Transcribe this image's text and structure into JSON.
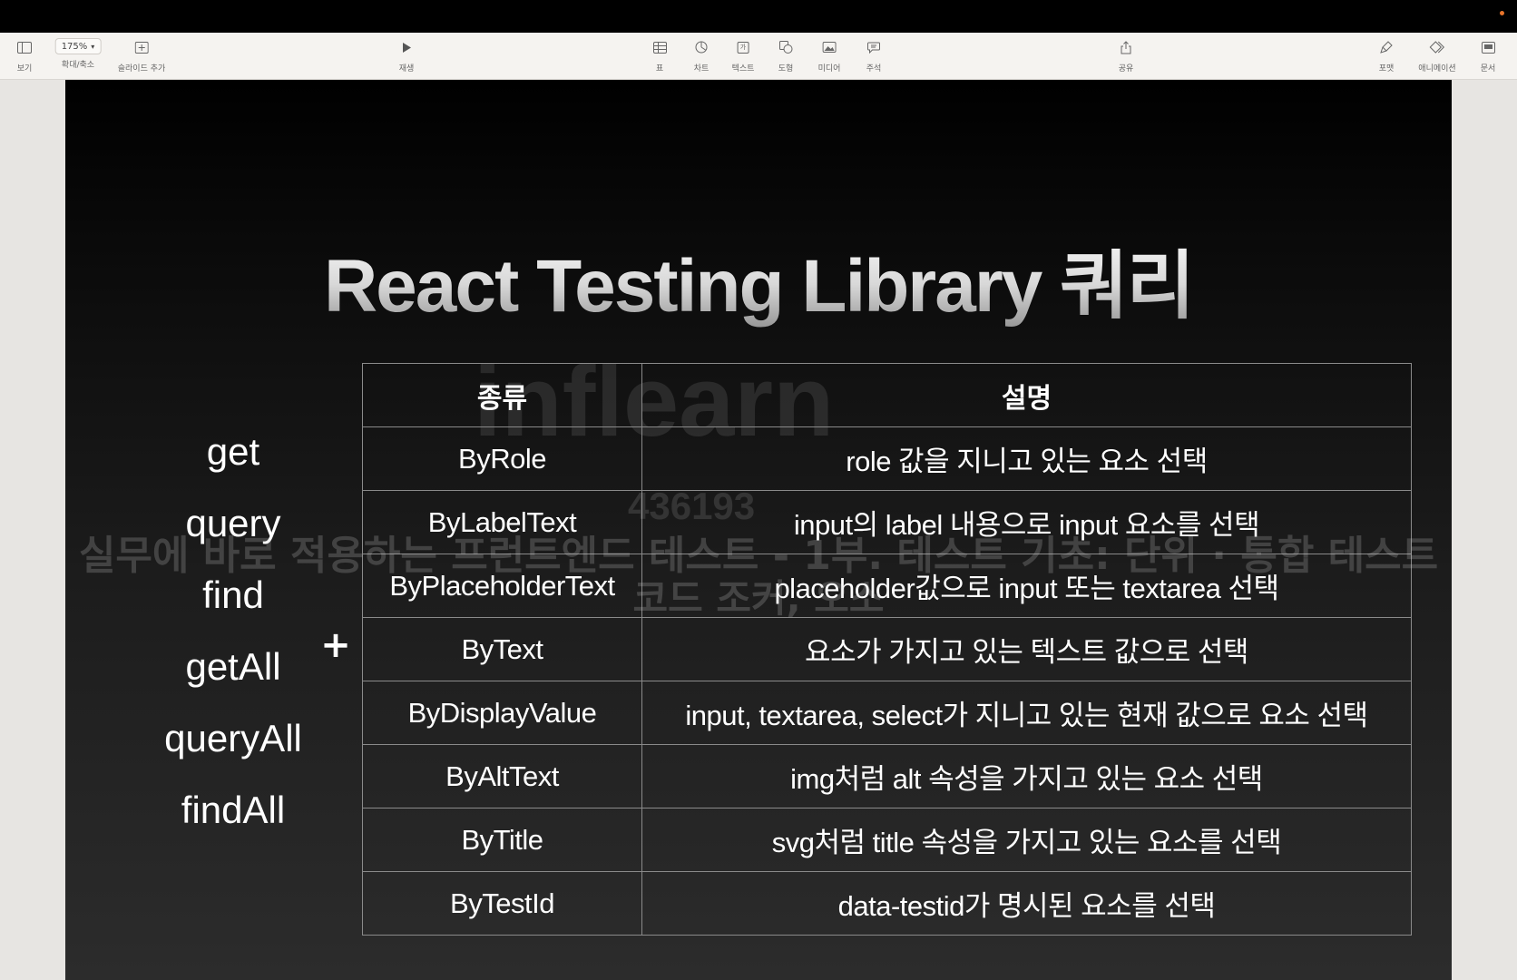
{
  "toolbar": {
    "view_label": "보기",
    "zoom_value": "175%",
    "zoom_label": "확대/축소",
    "add_slide_label": "슬라이드 추가",
    "play_label": "재생",
    "table_label": "표",
    "chart_label": "차트",
    "text_label": "텍스트",
    "shape_label": "도형",
    "media_label": "미디어",
    "comment_label": "주석",
    "share_label": "공유",
    "format_label": "포맷",
    "animate_label": "애니메이션",
    "document_label": "문서",
    "text_icon_glyph": "가"
  },
  "slide": {
    "title": "React Testing Library 쿼리",
    "plus_sign": "+",
    "methods": [
      "get",
      "query",
      "find",
      "getAll",
      "queryAll",
      "findAll"
    ],
    "table": {
      "headers": [
        "종류",
        "설명"
      ],
      "rows": [
        [
          "ByRole",
          "role 값을 지니고 있는 요소 선택"
        ],
        [
          "ByLabelText",
          "input의 label 내용으로 input 요소를 선택"
        ],
        [
          "ByPlaceholderText",
          "placeholder값으로 input 또는 textarea 선택"
        ],
        [
          "ByText",
          "요소가 가지고 있는 텍스트 값으로 선택"
        ],
        [
          "ByDisplayValue",
          "input, textarea, select가 지니고 있는 현재 값으로 요소 선택"
        ],
        [
          "ByAltText",
          "img처럼 alt 속성을 가지고 있는 요소 선택"
        ],
        [
          "ByTitle",
          "svg처럼 title 속성을 가지고 있는 요소를 선택"
        ],
        [
          "ByTestId",
          "data-testid가 명시된 요소를 선택"
        ]
      ]
    }
  },
  "watermark": {
    "logo_text": "inflearn",
    "id_text": "436193",
    "line1": "실무에 바로 적용하는 프런트엔드 테스트 - 1부. 테스트 기초: 단위 · 통합 테스트",
    "line2": "코드 조커, 오소"
  },
  "colors": {
    "accent_dot": "#e8742a",
    "toolbar_bg": "#f5f3f0",
    "slide_bg_top": "#000000",
    "slide_bg_bottom": "#2c2c2c"
  }
}
